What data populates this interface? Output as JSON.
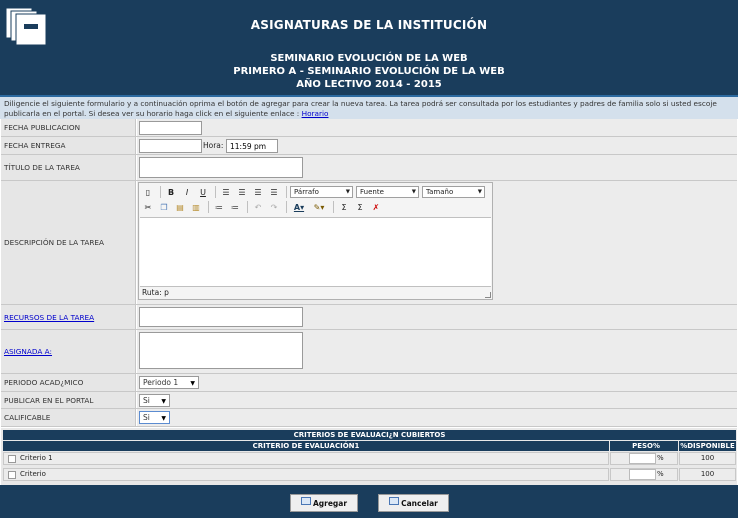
{
  "header": {
    "title": "ASIGNATURAS DE LA INSTITUCIÓN",
    "line1": "SEMINARIO EVOLUCIÓN DE LA WEB",
    "line2": "PRIMERO A - SEMINARIO EVOLUCIÓN DE LA WEB",
    "line3": "AÑO LECTIVO 2014 - 2015",
    "logo_icon": "folders-icon"
  },
  "notice": {
    "text": "Diligencie el siguiente formulario y a continuación oprima el botón de agregar para crear la nueva tarea. La tarea podrá ser consultada por los estudiantes y padres de familia solo si usted escoje publicarla en el portal. Si desea ver su horario haga click en el siguiente enlace :",
    "link": "Horario"
  },
  "form": {
    "fecha_publicacion": {
      "label": "FECHA PUBLICACION",
      "value": ""
    },
    "fecha_entrega": {
      "label": "FECHA ENTREGA",
      "value": "",
      "hora_label": "Hora:",
      "hora_value": "11:59 pm"
    },
    "titulo": {
      "label": "TÍTULO DE LA TAREA",
      "value": ""
    },
    "descripcion": {
      "label": "DESCRIPCIÓN DE LA TAREA",
      "parrafo": "Párrafo",
      "fuente": "Fuente",
      "tamano": "Tamaño",
      "path": "Ruta: p"
    },
    "recursos": {
      "label": "RECURSOS DE LA TAREA"
    },
    "asignada": {
      "label": "ASIGNADA A:"
    },
    "periodo": {
      "label": "PERIODO ACAD¿MICO",
      "value": "Periodo 1"
    },
    "publicar": {
      "label": "PUBLICAR EN EL PORTAL",
      "value": "Si"
    },
    "calificable": {
      "label": "CALIFICABLE",
      "value": "Si"
    }
  },
  "criterios": {
    "caption": "CRITERIOS DE EVALUACI¿N CUBIERTOS",
    "col_criterio": "CRITERIO DE EVALUACIÓN1",
    "col_peso": "PESO%",
    "col_disp": "%DISPONIBLE",
    "rows": [
      {
        "name": "Criterio 1",
        "pct": "%",
        "disp": "100"
      },
      {
        "name": "Criterio",
        "pct": "%",
        "disp": "100"
      }
    ]
  },
  "buttons": {
    "agregar": "Agregar",
    "cancelar": "Cancelar"
  }
}
